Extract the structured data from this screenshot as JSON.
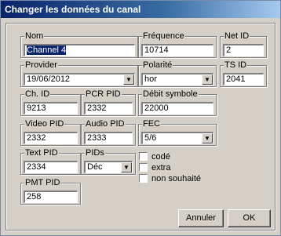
{
  "window": {
    "title": "Changer les données du canal"
  },
  "fields": {
    "nom": {
      "label": "Nom",
      "value": "Channel 4"
    },
    "frequence": {
      "label": "Fréquence",
      "value": "10714"
    },
    "net_id": {
      "label": "Net ID",
      "value": "2"
    },
    "provider": {
      "label": "Provider",
      "value": "19/06/2012"
    },
    "polarite": {
      "label": "Polarité",
      "value": "hor"
    },
    "ts_id": {
      "label": "TS ID",
      "value": "2041"
    },
    "ch_id": {
      "label": "Ch. ID",
      "value": "9213"
    },
    "pcr_pid": {
      "label": "PCR PID",
      "value": "2332"
    },
    "debit_symbole": {
      "label": "Débit symbole",
      "value": "22000"
    },
    "video_pid": {
      "label": "Video PID",
      "value": "2332"
    },
    "audio_pid": {
      "label": "Audio PID",
      "value": "2333"
    },
    "fec": {
      "label": "FEC",
      "value": "5/6"
    },
    "text_pid": {
      "label": "Text PID",
      "value": "2334"
    },
    "pids": {
      "label": "PIDs",
      "value": "Déc"
    },
    "pmt_pid": {
      "label": "PMT PID",
      "value": "258"
    }
  },
  "checkboxes": {
    "code": {
      "label": "codé",
      "checked": false
    },
    "extra": {
      "label": "extra",
      "checked": false
    },
    "non_souhaite": {
      "label": "non souhaité",
      "checked": false
    }
  },
  "buttons": {
    "annuler": "Annuler",
    "ok": "OK"
  },
  "icons": {
    "dropdown": "chevron-down-icon"
  }
}
